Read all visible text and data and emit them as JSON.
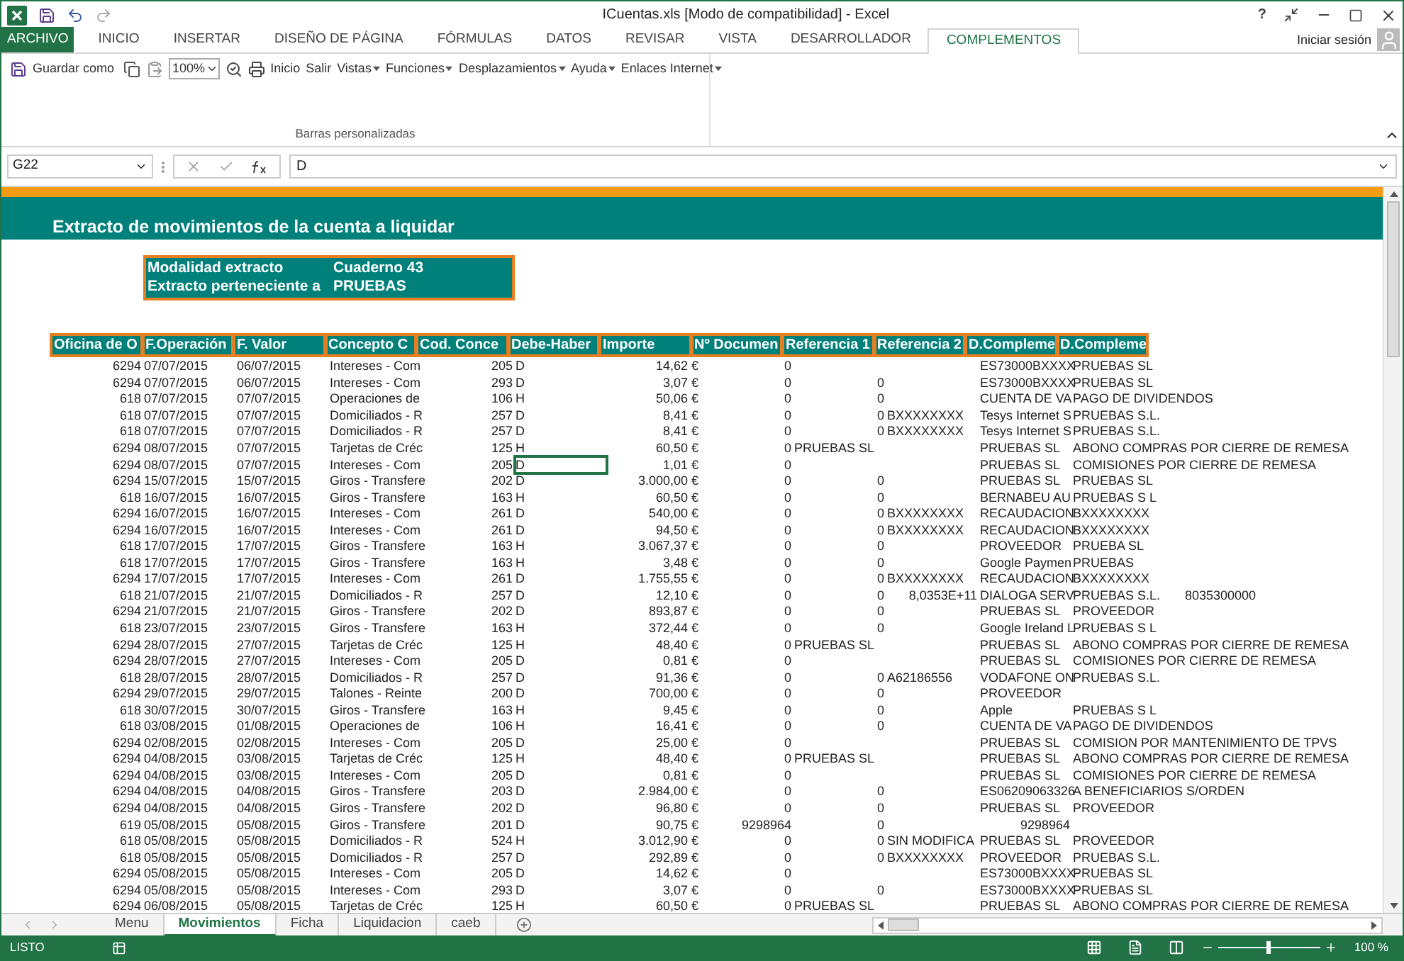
{
  "window": {
    "title": "ICuentas.xls  [Modo de compatibilidad] - Excel",
    "help": "?"
  },
  "ribbon_tabs": [
    {
      "label": "ARCHIVO",
      "kind": "file",
      "selected": false
    },
    {
      "label": "INICIO",
      "kind": "tab",
      "selected": false
    },
    {
      "label": "INSERTAR",
      "kind": "tab",
      "selected": false
    },
    {
      "label": "DISEÑO DE PÁGINA",
      "kind": "tab",
      "selected": false
    },
    {
      "label": "FÓRMULAS",
      "kind": "tab",
      "selected": false
    },
    {
      "label": "DATOS",
      "kind": "tab",
      "selected": false
    },
    {
      "label": "REVISAR",
      "kind": "tab",
      "selected": false
    },
    {
      "label": "VISTA",
      "kind": "tab",
      "selected": false
    },
    {
      "label": "DESARROLLADOR",
      "kind": "tab",
      "selected": false
    },
    {
      "label": "COMPLEMENTOS",
      "kind": "tab",
      "selected": true
    }
  ],
  "account": {
    "label": "Iniciar sesión"
  },
  "toolbar": {
    "items": [
      {
        "kind": "save",
        "label": "Guardar como"
      },
      {
        "kind": "copy"
      },
      {
        "kind": "paste"
      },
      {
        "kind": "zoom",
        "value": "100%"
      },
      {
        "kind": "preview"
      },
      {
        "kind": "print",
        "label": "Inicio"
      },
      {
        "kind": "button",
        "label": "Salir"
      },
      {
        "kind": "menu",
        "label": "Vistas"
      },
      {
        "kind": "menu",
        "label": "Funciones"
      },
      {
        "kind": "menu",
        "label": "Desplazamientos"
      },
      {
        "kind": "menu",
        "label": "Ayuda"
      },
      {
        "kind": "menu",
        "label": "Enlaces Internet"
      }
    ],
    "group_label": "Barras personalizadas"
  },
  "formula_bar": {
    "name_box": "G22",
    "value": "D"
  },
  "sheet": {
    "title": "Extracto de movimientos de la cuenta a liquidar",
    "info": [
      {
        "label": "Modalidad extracto",
        "value": "Cuaderno 43"
      },
      {
        "label": "Extracto perteneciente a",
        "value": "PRUEBAS"
      }
    ],
    "columns": [
      "Oficina de O",
      "F.Operación",
      "F. Valor",
      "Concepto C",
      "Cod. Conce",
      "Debe-Haber",
      "Importe",
      "Nº Documen",
      "Referencia 1",
      "Referencia 2",
      "D.Compleme",
      "D.Compleme"
    ],
    "rows": [
      {
        "selected": false,
        "cells": [
          "6294",
          "07/07/2015",
          "06/07/2015",
          "Intereses - Com",
          "205",
          "D",
          "14,62 €",
          "0",
          null,
          null,
          "ES73000BXXXX",
          "PRUEBAS SL",
          null
        ]
      },
      {
        "selected": false,
        "cells": [
          "6294",
          "07/07/2015",
          "06/07/2015",
          "Intereses - Com",
          "293",
          "D",
          "3,07 €",
          "0",
          "0",
          null,
          "ES73000BXXXX",
          "PRUEBAS SL",
          null
        ]
      },
      {
        "selected": false,
        "cells": [
          "618",
          "07/07/2015",
          "07/07/2015",
          "Operaciones de",
          "106",
          "H",
          "50,06 €",
          "0",
          "0",
          null,
          "CUENTA DE VA",
          "PAGO DE DIVIDENDOS",
          null
        ]
      },
      {
        "selected": false,
        "cells": [
          "618",
          "07/07/2015",
          "07/07/2015",
          "Domiciliados - R",
          "257",
          "D",
          "8,41 €",
          "0",
          "0",
          "BXXXXXXXX",
          "Tesys Internet S",
          "PRUEBAS S.L.",
          null
        ]
      },
      {
        "selected": false,
        "cells": [
          "618",
          "07/07/2015",
          "07/07/2015",
          "Domiciliados - R",
          "257",
          "D",
          "8,41 €",
          "0",
          "0",
          "BXXXXXXXX",
          "Tesys Internet S",
          "PRUEBAS S.L.",
          null
        ]
      },
      {
        "selected": false,
        "cells": [
          "6294",
          "08/07/2015",
          "07/07/2015",
          "Tarjetas de Créc",
          "125",
          "H",
          "60,50 €",
          "0",
          "PRUEBAS SL",
          null,
          "PRUEBAS SL",
          "ABONO COMPRAS POR CIERRE DE REMESA",
          null
        ]
      },
      {
        "selected": true,
        "cells": [
          "6294",
          "08/07/2015",
          "07/07/2015",
          "Intereses - Com",
          "205",
          "D",
          "1,01 €",
          "0",
          null,
          null,
          "PRUEBAS SL",
          "COMISIONES POR CIERRE DE REMESA",
          null
        ]
      },
      {
        "selected": false,
        "cells": [
          "6294",
          "15/07/2015",
          "15/07/2015",
          "Giros - Transfere",
          "202",
          "D",
          "3.000,00 €",
          "0",
          "0",
          null,
          "PRUEBAS SL",
          "PRUEBAS SL",
          null
        ]
      },
      {
        "selected": false,
        "cells": [
          "618",
          "16/07/2015",
          "16/07/2015",
          "Giros - Transfere",
          "163",
          "H",
          "60,50 €",
          "0",
          "0",
          null,
          "BERNABEU AU",
          "PRUEBAS S L",
          null
        ]
      },
      {
        "selected": false,
        "cells": [
          "6294",
          "16/07/2015",
          "16/07/2015",
          "Intereses - Com",
          "261",
          "D",
          "540,00 €",
          "0",
          "0",
          "BXXXXXXXX",
          "RECAUDACION",
          "BXXXXXXXX",
          null
        ]
      },
      {
        "selected": false,
        "cells": [
          "6294",
          "16/07/2015",
          "16/07/2015",
          "Intereses - Com",
          "261",
          "D",
          "94,50 €",
          "0",
          "0",
          "BXXXXXXXX",
          "RECAUDACION",
          "BXXXXXXXX",
          null
        ]
      },
      {
        "selected": false,
        "cells": [
          "618",
          "17/07/2015",
          "17/07/2015",
          "Giros - Transfere",
          "163",
          "H",
          "3.067,37 €",
          "0",
          "0",
          null,
          "PROVEEDOR",
          "PRUEBA SL",
          null
        ]
      },
      {
        "selected": false,
        "cells": [
          "618",
          "17/07/2015",
          "17/07/2015",
          "Giros - Transfere",
          "163",
          "H",
          "3,48 €",
          "0",
          "0",
          null,
          "Google Paymen",
          "PRUEBAS",
          null
        ]
      },
      {
        "selected": false,
        "cells": [
          "6294",
          "17/07/2015",
          "17/07/2015",
          "Intereses - Com",
          "261",
          "D",
          "1.755,55 €",
          "0",
          "0",
          "BXXXXXXXX",
          "RECAUDACION",
          "BXXXXXXXX",
          null
        ]
      },
      {
        "selected": false,
        "cells": [
          "618",
          "21/07/2015",
          "21/07/2015",
          "Domiciliados - R",
          "257",
          "D",
          "12,10 €",
          "0",
          "0",
          "8,0353E+11",
          "DIALOGA SERV",
          "PRUEBAS S.L.",
          "8035300000"
        ]
      },
      {
        "selected": false,
        "cells": [
          "6294",
          "21/07/2015",
          "21/07/2015",
          "Giros - Transfere",
          "202",
          "D",
          "893,87 €",
          "0",
          "0",
          null,
          "PRUEBAS SL",
          "PROVEEDOR",
          null
        ]
      },
      {
        "selected": false,
        "cells": [
          "618",
          "23/07/2015",
          "23/07/2015",
          "Giros - Transfere",
          "163",
          "H",
          "372,44 €",
          "0",
          "0",
          null,
          "Google Ireland L",
          "PRUEBAS S L",
          null
        ]
      },
      {
        "selected": false,
        "cells": [
          "6294",
          "28/07/2015",
          "27/07/2015",
          "Tarjetas de Créc",
          "125",
          "H",
          "48,40 €",
          "0",
          "PRUEBAS SL",
          null,
          "PRUEBAS SL",
          "ABONO COMPRAS POR CIERRE DE REMESA",
          null
        ]
      },
      {
        "selected": false,
        "cells": [
          "6294",
          "28/07/2015",
          "27/07/2015",
          "Intereses - Com",
          "205",
          "D",
          "0,81 €",
          "0",
          null,
          null,
          "PRUEBAS SL",
          "COMISIONES POR CIERRE DE REMESA",
          null
        ]
      },
      {
        "selected": false,
        "cells": [
          "618",
          "28/07/2015",
          "28/07/2015",
          "Domiciliados - R",
          "257",
          "D",
          "91,36 €",
          "0",
          "0",
          "A62186556",
          "VODAFONE ON",
          "PRUEBAS S.L.",
          null
        ]
      },
      {
        "selected": false,
        "cells": [
          "6294",
          "29/07/2015",
          "29/07/2015",
          "Talones - Reinte",
          "200",
          "D",
          "700,00 €",
          "0",
          "0",
          null,
          "PROVEEDOR",
          null,
          null
        ]
      },
      {
        "selected": false,
        "cells": [
          "618",
          "30/07/2015",
          "30/07/2015",
          "Giros - Transfere",
          "163",
          "H",
          "9,45 €",
          "0",
          "0",
          null,
          "Apple",
          "PRUEBAS S L",
          null
        ]
      },
      {
        "selected": false,
        "cells": [
          "618",
          "03/08/2015",
          "01/08/2015",
          "Operaciones de",
          "106",
          "H",
          "16,41 €",
          "0",
          "0",
          null,
          "CUENTA DE VA",
          "PAGO DE DIVIDENDOS",
          null
        ]
      },
      {
        "selected": false,
        "cells": [
          "6294",
          "02/08/2015",
          "02/08/2015",
          "Intereses - Com",
          "205",
          "D",
          "25,00 €",
          "0",
          null,
          null,
          "PRUEBAS SL",
          "COMISION POR MANTENIMIENTO DE TPVS",
          null
        ]
      },
      {
        "selected": false,
        "cells": [
          "6294",
          "04/08/2015",
          "03/08/2015",
          "Tarjetas de Créc",
          "125",
          "H",
          "48,40 €",
          "0",
          "PRUEBAS SL",
          null,
          "PRUEBAS SL",
          "ABONO COMPRAS POR CIERRE DE REMESA",
          null
        ]
      },
      {
        "selected": false,
        "cells": [
          "6294",
          "04/08/2015",
          "03/08/2015",
          "Intereses - Com",
          "205",
          "D",
          "0,81 €",
          "0",
          null,
          null,
          "PRUEBAS SL",
          "COMISIONES POR CIERRE DE REMESA",
          null
        ]
      },
      {
        "selected": false,
        "cells": [
          "6294",
          "04/08/2015",
          "04/08/2015",
          "Giros - Transfere",
          "203",
          "D",
          "2.984,00 €",
          "0",
          "0",
          null,
          "ES06209063326",
          "A BENEFICIARIOS S/ORDEN",
          null
        ]
      },
      {
        "selected": false,
        "cells": [
          "6294",
          "04/08/2015",
          "04/08/2015",
          "Giros - Transfere",
          "202",
          "D",
          "96,80 €",
          "0",
          "0",
          null,
          "PRUEBAS SL",
          "PROVEEDOR",
          null
        ]
      },
      {
        "selected": false,
        "cells": [
          "619",
          "05/08/2015",
          "05/08/2015",
          "Giros - Transfere",
          "201",
          "D",
          "90,75 €",
          "9298964",
          "0",
          null,
          "9298964",
          null,
          null
        ]
      },
      {
        "selected": false,
        "cells": [
          "618",
          "05/08/2015",
          "05/08/2015",
          "Domiciliados - R",
          "524",
          "H",
          "3.012,90 €",
          "0",
          "0",
          "SIN MODIFICA",
          "PRUEBAS SL",
          "PROVEEDOR",
          null
        ]
      },
      {
        "selected": false,
        "cells": [
          "618",
          "05/08/2015",
          "05/08/2015",
          "Domiciliados - R",
          "257",
          "D",
          "292,89 €",
          "0",
          "0",
          "BXXXXXXXX",
          "PROVEEDOR",
          "PRUEBAS S.L.",
          null
        ]
      },
      {
        "selected": false,
        "cells": [
          "6294",
          "05/08/2015",
          "05/08/2015",
          "Intereses - Com",
          "205",
          "D",
          "14,62 €",
          "0",
          null,
          null,
          "ES73000BXXXX",
          "PRUEBAS SL",
          null
        ]
      },
      {
        "selected": false,
        "cells": [
          "6294",
          "05/08/2015",
          "05/08/2015",
          "Intereses - Com",
          "293",
          "D",
          "3,07 €",
          "0",
          "0",
          null,
          "ES73000BXXXX",
          "PRUEBAS SL",
          null
        ]
      },
      {
        "selected": false,
        "cells": [
          "6294",
          "06/08/2015",
          "05/08/2015",
          "Tarjetas de Créc",
          "125",
          "H",
          "60,50 €",
          "0",
          "PRUEBAS SL",
          null,
          "PRUEBAS SL",
          "ABONO COMPRAS POR CIERRE DE REMESA",
          null
        ]
      }
    ]
  },
  "sheet_tabs": [
    {
      "label": "Menu",
      "selected": false
    },
    {
      "label": "Movimientos",
      "selected": true
    },
    {
      "label": "Ficha",
      "selected": false
    },
    {
      "label": "Liquidacion",
      "selected": false
    },
    {
      "label": "caeb",
      "selected": false
    }
  ],
  "status_bar": {
    "mode": "LISTO",
    "zoom": "100 %",
    "zoom_slider": {
      "level": 0.5
    }
  }
}
